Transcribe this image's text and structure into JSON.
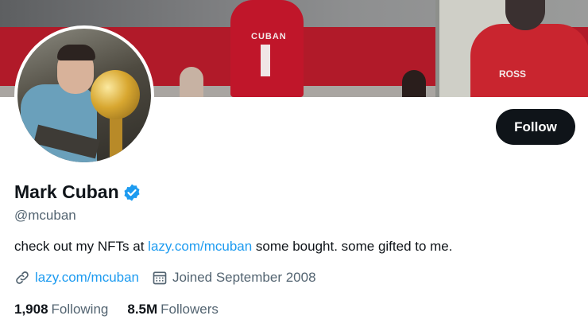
{
  "profile": {
    "display_name": "Mark Cuban",
    "handle": "@mcuban",
    "bio_text_before": "check out my NFTs at ",
    "bio_link": "lazy.com/mcuban",
    "bio_text_after": " some bought. some gifted to me.",
    "website": "lazy.com/mcuban",
    "joined": "Joined September 2008",
    "verified": true
  },
  "actions": {
    "follow_label": "Follow"
  },
  "stats": {
    "following_count": "1,908",
    "following_label": "Following",
    "followers_count": "8.5M",
    "followers_label": "Followers"
  },
  "banner": {
    "jersey_name_left": "CUBAN",
    "jersey_name_right": "ROSS"
  },
  "colors": {
    "accent": "#1d9bf0",
    "text_primary": "#0f1419",
    "text_secondary": "#536471",
    "button_bg": "#0f1419"
  },
  "icons": {
    "verified": "verified-badge-icon",
    "website": "link-icon",
    "joined": "calendar-icon"
  }
}
